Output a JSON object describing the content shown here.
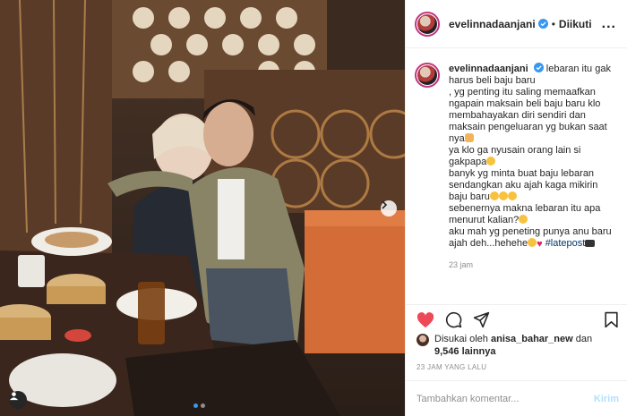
{
  "post": {
    "username": "evelinnadaanjani",
    "separator": "•",
    "follow_label": "Diikuti",
    "more_label": "..."
  },
  "caption": {
    "username": "evelinnadaanjani",
    "lines": [
      "lebaran itu gak harus beli baju baru",
      ", yg penting itu saling memaafkan ngapain maksain beli baju baru klo membahayakan diri sendiri dan maksain pengeluaran yg bukan saat nya",
      "ya klo ga nyusain orang lain si gakpapa",
      "banyk yg minta buat baju lebaran sendangkan aku ajah kaga mikirin baju baru",
      "sebenernya makna lebaran itu apa menurut kalian?",
      "aku mah yg peneting punya anu baru ajah deh...hehehe"
    ],
    "hashtag": "#latepost",
    "time": "23 jam"
  },
  "likes": {
    "prefix": "Disukai oleh",
    "user": "anisa_bahar_new",
    "joiner": "dan",
    "count": "9,546 lainnya"
  },
  "time_ago": "23 JAM YANG LALU",
  "comment": {
    "placeholder": "Tambahkan komentar...",
    "post_label": "Kirim"
  },
  "carousel": {
    "current": 1,
    "total": 2
  },
  "colors": {
    "verified": "#3897f0",
    "like": "#ed4956",
    "story_ring": "#c13584"
  }
}
